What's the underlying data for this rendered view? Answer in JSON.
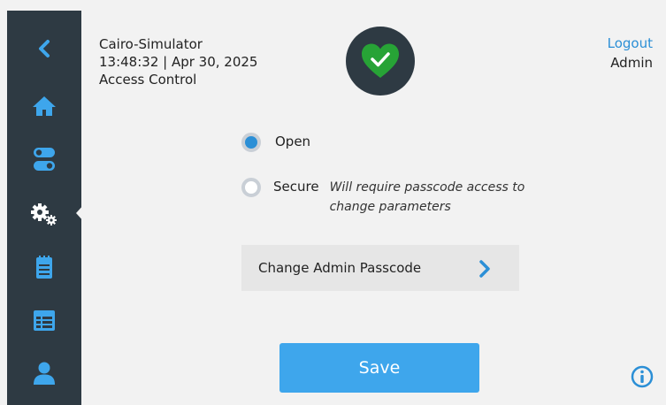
{
  "sidebar": {
    "items": [
      {
        "icon": "back-chevron-icon"
      },
      {
        "icon": "home-icon"
      },
      {
        "icon": "toggle-switches-icon"
      },
      {
        "icon": "settings-gears-icon",
        "active": true
      },
      {
        "icon": "notepad-icon"
      },
      {
        "icon": "calendar-list-icon"
      },
      {
        "icon": "user-icon"
      }
    ]
  },
  "header": {
    "device": "Cairo-Simulator",
    "datetime": "13:48:32 | Apr 30, 2025",
    "page": "Access Control",
    "status_icon": "green-heart-check-icon",
    "logout": "Logout",
    "user": "Admin"
  },
  "access": {
    "options": [
      {
        "label": "Open",
        "selected": true,
        "note": ""
      },
      {
        "label": "Secure",
        "selected": false,
        "note": "Will require passcode access to change parameters"
      }
    ]
  },
  "change_passcode": {
    "label": "Change Admin Passcode"
  },
  "save": {
    "label": "Save"
  },
  "colors": {
    "sidebar": "#2e3a43",
    "accent": "#2b8fd6",
    "save": "#3ea6ec",
    "status_green": "#27a336"
  }
}
